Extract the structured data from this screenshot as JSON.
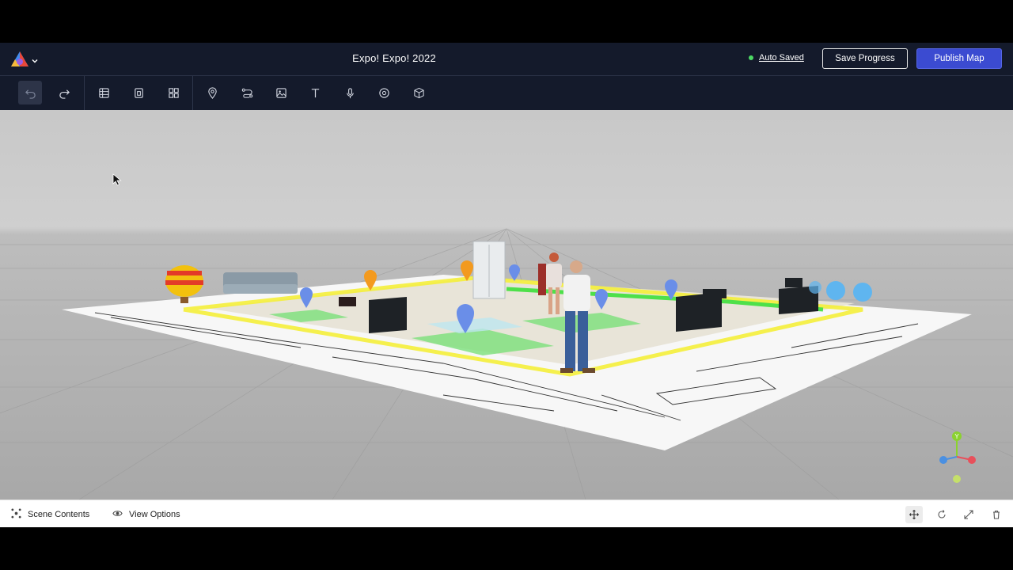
{
  "header": {
    "title": "Expo! Expo! 2022",
    "status_label": "Auto Saved",
    "save_label": "Save Progress",
    "publish_label": "Publish Map",
    "logo_icon": "app-logo-icon",
    "menu_icon": "chevron-down-icon"
  },
  "toolbar": {
    "items": [
      {
        "name": "undo-icon"
      },
      {
        "name": "redo-icon"
      },
      {
        "name": "floorplan-icon"
      },
      {
        "name": "zone-icon"
      },
      {
        "name": "grid-icon"
      },
      {
        "name": "pin-icon"
      },
      {
        "name": "path-icon"
      },
      {
        "name": "image-icon"
      },
      {
        "name": "text-icon"
      },
      {
        "name": "microphone-icon"
      },
      {
        "name": "target-icon"
      },
      {
        "name": "cube-icon"
      }
    ]
  },
  "bottom_bar": {
    "scene_contents_label": "Scene Contents",
    "view_options_label": "View Options",
    "tools": [
      "move-icon",
      "rotate-icon",
      "scale-icon",
      "trash-icon"
    ]
  },
  "viewport": {
    "gizmo_axis_label": "Y"
  },
  "colors": {
    "header_bg": "#141a2b",
    "publish_button": "#3b4bd1",
    "status_dot": "#4cd964",
    "path_yellow": "#f4ee3a",
    "path_green": "#4ee04a"
  }
}
